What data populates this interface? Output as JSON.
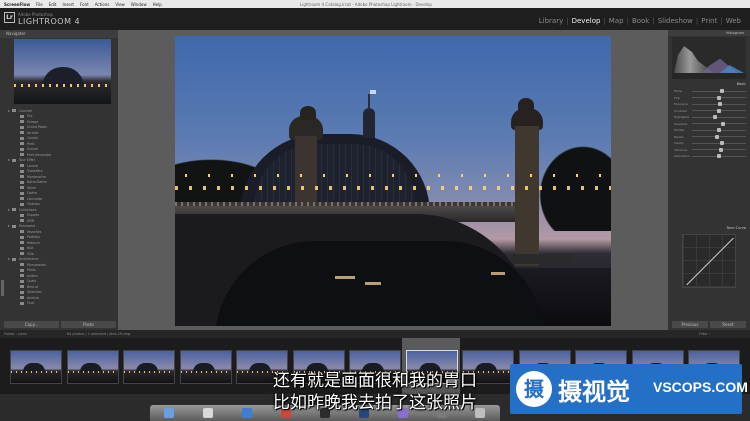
{
  "menubar": {
    "app": "ScreenFlow",
    "items": [
      "File",
      "Edit",
      "Insert",
      "Font",
      "Actions",
      "View",
      "Window",
      "Help"
    ],
    "window_title": "Lightroom 4 Catalog.lrcat - Adobe Photoshop Lightroom - Develop",
    "clock": "mar. 19 juin 21:58",
    "user": "Serge Ramelli"
  },
  "identity": {
    "badge": "Lr",
    "small": "Adobe Photoshop",
    "title": "LIGHTROOM 4"
  },
  "modules": [
    "Library",
    "Develop",
    "Map",
    "Book",
    "Slideshow",
    "Print",
    "Web"
  ],
  "active_module": "Develop",
  "left_panel": {
    "header": "Navigator",
    "folders": [
      "Coucher",
      "Oui",
      "Europe",
      "Grand Palais",
      "Arrivée",
      "Couloir",
      "Paris",
      "Sunset",
      "Pont Alexandre",
      "Tour Eiffel",
      "Louvre",
      "Trocadéro",
      "Montmartre",
      "Notre-Dame",
      "Seine",
      "Opéra",
      "Concorde",
      "Champs",
      "Collections",
      "Exports",
      "HDR",
      "Panorama",
      "Favorites",
      "Portfolio",
      "Retouch",
      "Nuit",
      "Ville",
      "Architecture",
      "Monuments",
      "Ponts",
      "Jardins",
      "Quais",
      "Best of",
      "Selection",
      "Archive",
      "Final"
    ],
    "copy_btn": "Copy...",
    "paste_btn": "Paste"
  },
  "right_panel": {
    "histogram_label": "Histogram",
    "basic_label": "Basic",
    "sliders": [
      {
        "label": "Temp",
        "value": 0.55
      },
      {
        "label": "Tint",
        "value": 0.5
      },
      {
        "label": "Exposure",
        "value": 0.52
      },
      {
        "label": "Contrast",
        "value": 0.5
      },
      {
        "label": "Highlights",
        "value": 0.42
      },
      {
        "label": "Shadows",
        "value": 0.58
      },
      {
        "label": "Whites",
        "value": 0.5
      },
      {
        "label": "Blacks",
        "value": 0.47
      },
      {
        "label": "Clarity",
        "value": 0.55
      },
      {
        "label": "Vibrance",
        "value": 0.53
      },
      {
        "label": "Saturation",
        "value": 0.5
      }
    ],
    "tone_curve_label": "Tone Curve",
    "previous_btn": "Previous",
    "reset_btn": "Reset"
  },
  "filmbar": {
    "left": "Folder : paris",
    "count": "64 photos / 1 selected / alex-19.dng",
    "filter": "Filter :"
  },
  "filmstrip": {
    "thumbnail_count": 13,
    "selected_index": 7
  },
  "subtitles": {
    "line1": "还有就是画面很和我的胃口",
    "line2": "比如昨晚我去拍了这张照片"
  },
  "watermark": {
    "logo": "摄",
    "cn": "摄视觉",
    "en": "VSCOPS.COM"
  },
  "colors": {
    "watermark_blue": "#2570c7",
    "panel_bg": "#333333",
    "accent_light": "#f0f0f0"
  }
}
